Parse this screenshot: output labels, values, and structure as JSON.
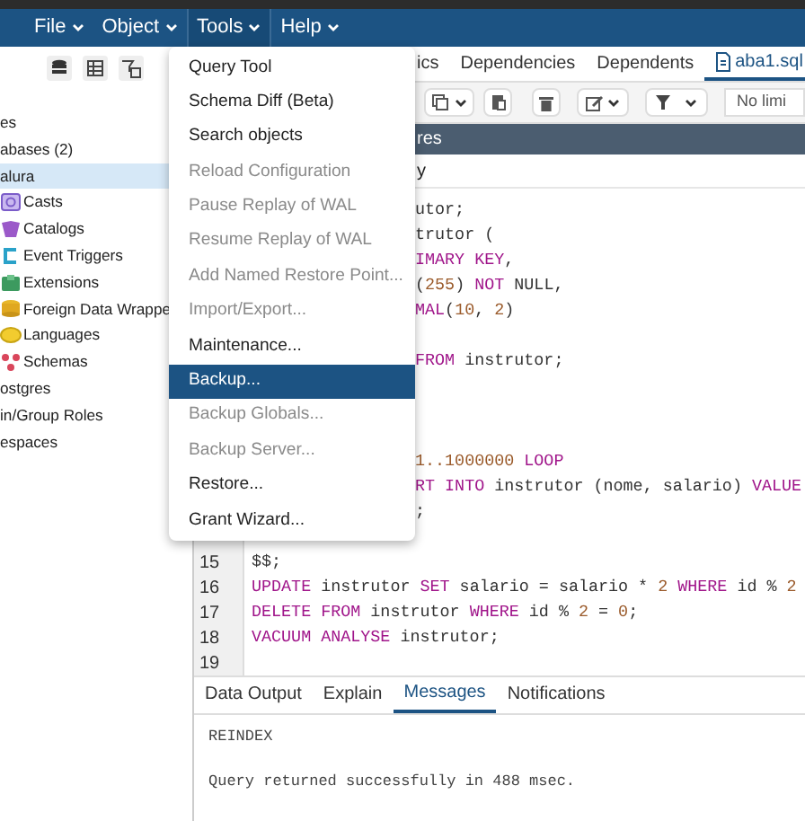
{
  "menubar": [
    {
      "label": "File",
      "active": false
    },
    {
      "label": "Object",
      "active": false
    },
    {
      "label": "Tools",
      "active": true
    },
    {
      "label": "Help",
      "active": false
    }
  ],
  "tree": [
    {
      "label": "es",
      "selected": false
    },
    {
      "label": "abases (2)",
      "selected": false
    },
    {
      "label": "alura",
      "selected": true,
      "children": [
        {
          "label": "Casts",
          "kind": "casts",
          "selected": false
        },
        {
          "label": "Catalogs",
          "kind": "catalogs",
          "selected": false
        },
        {
          "label": "Event Triggers",
          "kind": "triggers",
          "selected": false
        },
        {
          "label": "Extensions",
          "kind": "extensions",
          "selected": false
        },
        {
          "label": "Foreign Data Wrappe",
          "kind": "wrappers",
          "selected": false
        },
        {
          "label": "Languages",
          "kind": "languages",
          "selected": false
        },
        {
          "label": "Schemas",
          "kind": "schemas",
          "selected": false
        }
      ]
    },
    {
      "label": "ostgres",
      "selected": false
    },
    {
      "label": "in/Group Roles",
      "selected": false
    },
    {
      "label": "espaces",
      "selected": false
    }
  ],
  "tools_menu": [
    {
      "label": "Query Tool",
      "disabled": false,
      "selected": false
    },
    {
      "label": "Schema Diff (Beta)",
      "disabled": false,
      "selected": false
    },
    {
      "label": "Search objects",
      "disabled": false,
      "selected": false
    },
    {
      "label": "Reload Configuration",
      "disabled": true,
      "selected": false
    },
    {
      "label": "Pause Replay of WAL",
      "disabled": true,
      "selected": false
    },
    {
      "label": "Resume Replay of WAL",
      "disabled": true,
      "selected": false
    },
    {
      "label": "Add Named Restore Point...",
      "disabled": true,
      "selected": false
    },
    {
      "label": "Import/Export...",
      "disabled": true,
      "selected": false
    },
    {
      "label": "Maintenance...",
      "disabled": false,
      "selected": false
    },
    {
      "label": "Backup...",
      "disabled": false,
      "selected": true
    },
    {
      "label": "Backup Globals...",
      "disabled": true,
      "selected": false
    },
    {
      "label": "Backup Server...",
      "disabled": true,
      "selected": false
    },
    {
      "label": "Restore...",
      "disabled": false,
      "selected": false
    },
    {
      "label": "Grant Wizard...",
      "disabled": false,
      "selected": false
    }
  ],
  "tabs": [
    {
      "label": "ics",
      "selected": false
    },
    {
      "label": "Dependencies",
      "selected": false
    },
    {
      "label": "Dependents",
      "selected": false
    },
    {
      "label": "aba1.sql",
      "selected": true
    }
  ],
  "toolbar": {
    "limit": "No limi"
  },
  "connection_bar": "res",
  "query_title": "y",
  "code": [
    {
      "kind": "text",
      "tokens": [
        {
          "kind": "plain",
          "text": "utor;"
        }
      ]
    },
    {
      "kind": "text",
      "tokens": [
        {
          "kind": "plain",
          "text": "trutor ("
        }
      ]
    },
    {
      "kind": "text",
      "tokens": [
        {
          "kind": "kw",
          "text": "IMARY KEY"
        },
        {
          "kind": "plain",
          "text": ","
        }
      ]
    },
    {
      "kind": "text",
      "tokens": [
        {
          "kind": "plain",
          "text": "("
        },
        {
          "kind": "num",
          "text": "255"
        },
        {
          "kind": "plain",
          "text": ") "
        },
        {
          "kind": "kw",
          "text": "NOT"
        },
        {
          "kind": "plain",
          "text": " NULL,"
        }
      ]
    },
    {
      "kind": "text",
      "tokens": [
        {
          "kind": "kw",
          "text": "MAL"
        },
        {
          "kind": "plain",
          "text": "("
        },
        {
          "kind": "num",
          "text": "10"
        },
        {
          "kind": "plain",
          "text": ", "
        },
        {
          "kind": "num",
          "text": "2"
        },
        {
          "kind": "plain",
          "text": ")"
        }
      ]
    },
    {
      "kind": "blank"
    },
    {
      "kind": "text",
      "tokens": [
        {
          "kind": "kw",
          "text": "FROM"
        },
        {
          "kind": "plain",
          "text": " instrutor;"
        }
      ]
    },
    {
      "kind": "blank"
    },
    {
      "kind": "blank"
    },
    {
      "kind": "blank"
    },
    {
      "kind": "text",
      "tokens": [
        {
          "kind": "num",
          "text": "1..1000000"
        },
        {
          "kind": "kw",
          "text": " LOOP"
        }
      ]
    },
    {
      "kind": "text",
      "tokens": [
        {
          "kind": "kw",
          "text": "RT INTO"
        },
        {
          "kind": "plain",
          "text": " instrutor (nome, salario) "
        },
        {
          "kind": "kw",
          "text": "VALUE"
        }
      ]
    },
    {
      "kind": "text",
      "tokens": [
        {
          "kind": "plain",
          "text": ";"
        }
      ]
    },
    {
      "kind": "blank"
    },
    {
      "kind": "text",
      "number": "15",
      "tokens": [
        {
          "kind": "plain",
          "text": "$$;"
        }
      ]
    },
    {
      "kind": "text",
      "number": "16",
      "tokens": [
        {
          "kind": "kw",
          "text": "UPDATE"
        },
        {
          "kind": "plain",
          "text": " instrutor "
        },
        {
          "kind": "kw",
          "text": "SET"
        },
        {
          "kind": "plain",
          "text": " salario = salario * "
        },
        {
          "kind": "num",
          "text": "2"
        },
        {
          "kind": "kw",
          "text": " WHERE"
        },
        {
          "kind": "plain",
          "text": " id % "
        },
        {
          "kind": "num",
          "text": "2"
        }
      ]
    },
    {
      "kind": "text",
      "number": "17",
      "tokens": [
        {
          "kind": "kw",
          "text": "DELETE FROM"
        },
        {
          "kind": "plain",
          "text": " instrutor "
        },
        {
          "kind": "kw",
          "text": "WHERE"
        },
        {
          "kind": "plain",
          "text": " id % "
        },
        {
          "kind": "num",
          "text": "2"
        },
        {
          "kind": "plain",
          "text": " = "
        },
        {
          "kind": "num",
          "text": "0"
        },
        {
          "kind": "plain",
          "text": ";"
        }
      ]
    },
    {
      "kind": "text",
      "number": "18",
      "tokens": [
        {
          "kind": "kw",
          "text": "VACUUM ANALYSE"
        },
        {
          "kind": "plain",
          "text": " instrutor;"
        }
      ]
    },
    {
      "kind": "blank",
      "number": "19"
    }
  ],
  "result_tabs": [
    {
      "label": "Data Output",
      "selected": false
    },
    {
      "label": "Explain",
      "selected": false
    },
    {
      "label": "Messages",
      "selected": true
    },
    {
      "label": "Notifications",
      "selected": false
    }
  ],
  "messages": [
    "REINDEX",
    "Query returned successfully in 488 msec."
  ]
}
